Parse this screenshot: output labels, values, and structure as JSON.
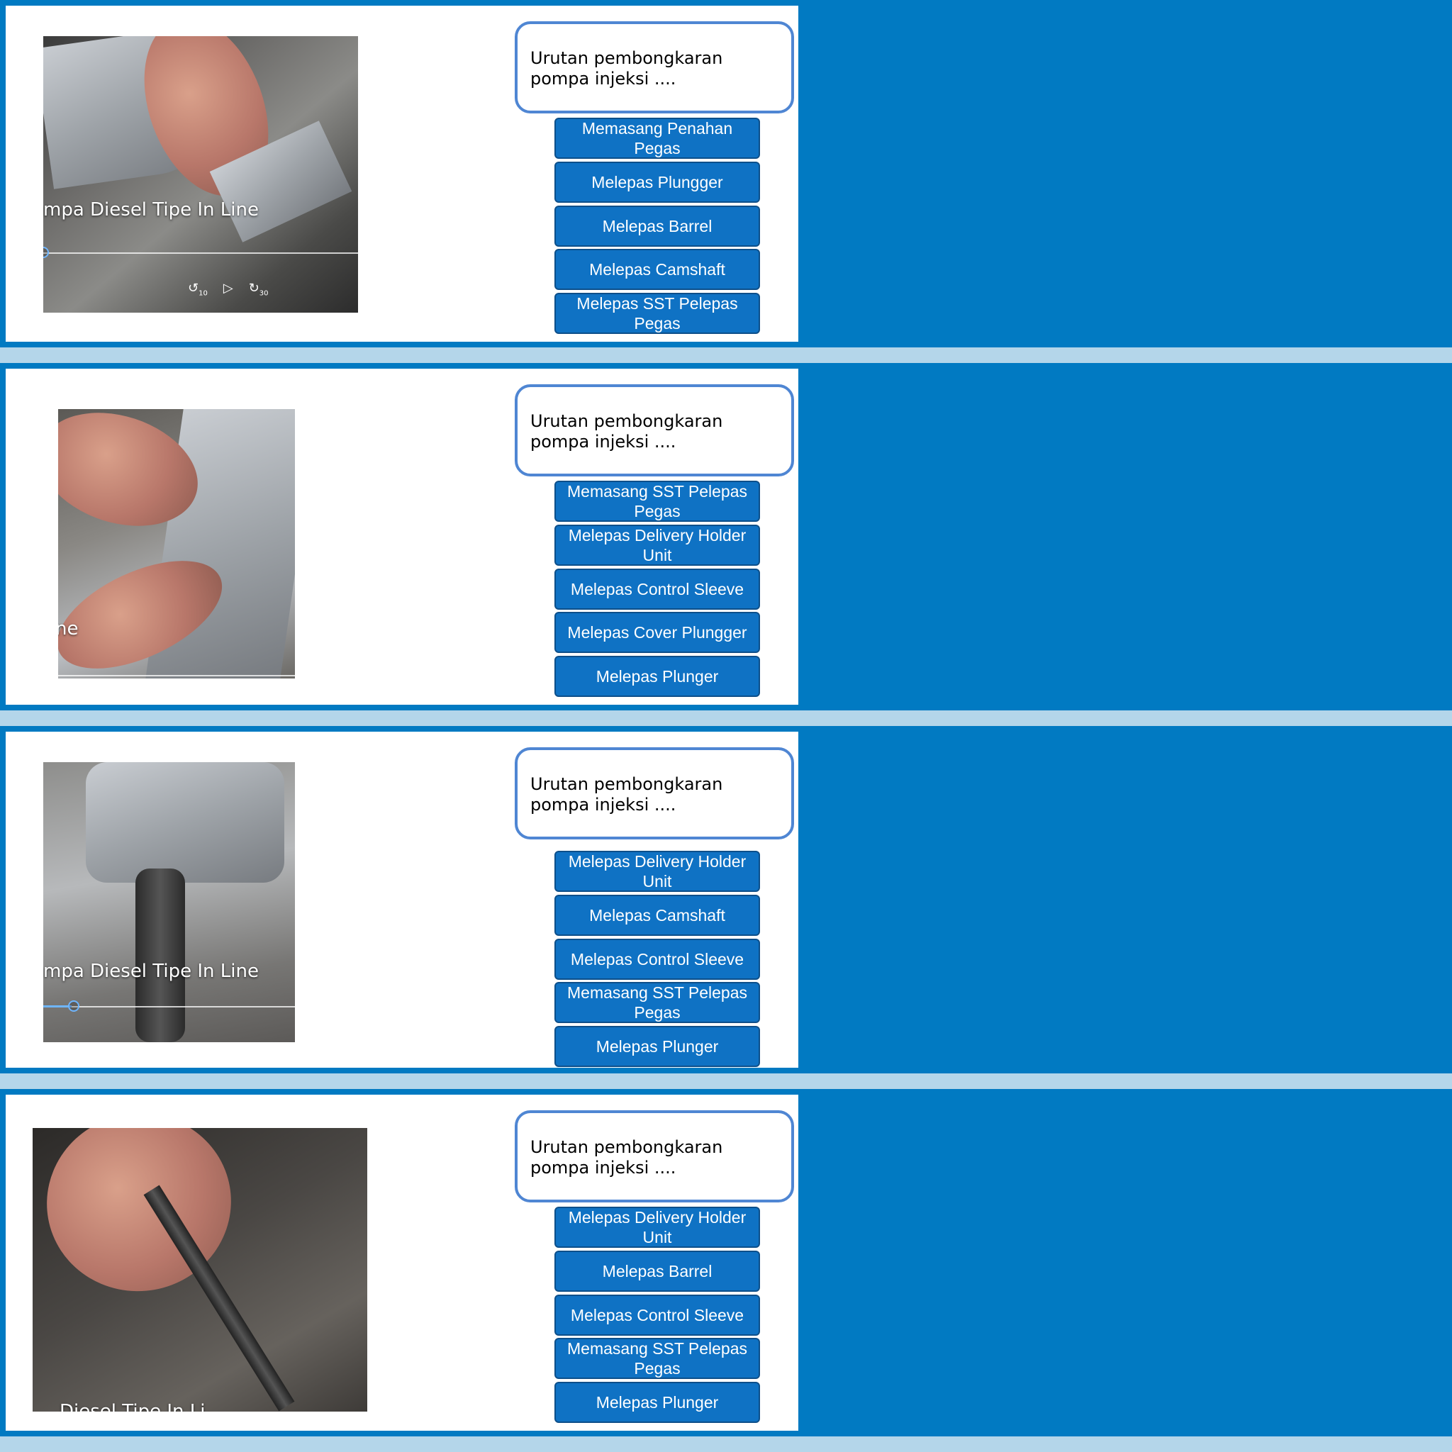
{
  "colors": {
    "band": "#017ac2",
    "gap": "#b4d6ea",
    "option_fill": "#0f72c4",
    "question_border": "#4f86d3"
  },
  "icons": [
    "rewind-10-icon",
    "play-icon",
    "forward-30-icon"
  ],
  "slides": [
    {
      "question": "Urutan pembongkaran\npompa injeksi ....",
      "video_title": "mpa Diesel Tipe In Line",
      "controls": {
        "rewind": "10",
        "play": "▷",
        "forward": "30"
      },
      "options": [
        "Memasang Penahan Pegas",
        "Melepas Plungger",
        "Melepas Barrel",
        "Melepas Camshaft",
        "Melepas SST Pelepas Pegas"
      ]
    },
    {
      "question": "Urutan pembongkaran\npompa injeksi ....",
      "video_title": "ne",
      "options": [
        "Memasang SST Pelepas Pegas",
        "Melepas Delivery Holder Unit",
        "Melepas Control Sleeve",
        "Melepas Cover Plungger",
        "Melepas Plunger"
      ]
    },
    {
      "question": "Urutan pembongkaran\npompa injeksi ....",
      "video_title": "mpa Diesel Tipe In Line",
      "options": [
        "Melepas Delivery Holder Unit",
        "Melepas Camshaft",
        "Melepas Control Sleeve",
        "Memasang SST Pelepas Pegas",
        "Melepas Plunger"
      ]
    },
    {
      "question": "Urutan pembongkaran\npompa injeksi ....",
      "video_title": "Diesel Tipe In Li",
      "options": [
        "Melepas Delivery Holder Unit",
        "Melepas Barrel",
        "Melepas Control Sleeve",
        "Memasang SST Pelepas Pegas",
        "Melepas Plunger"
      ]
    }
  ]
}
